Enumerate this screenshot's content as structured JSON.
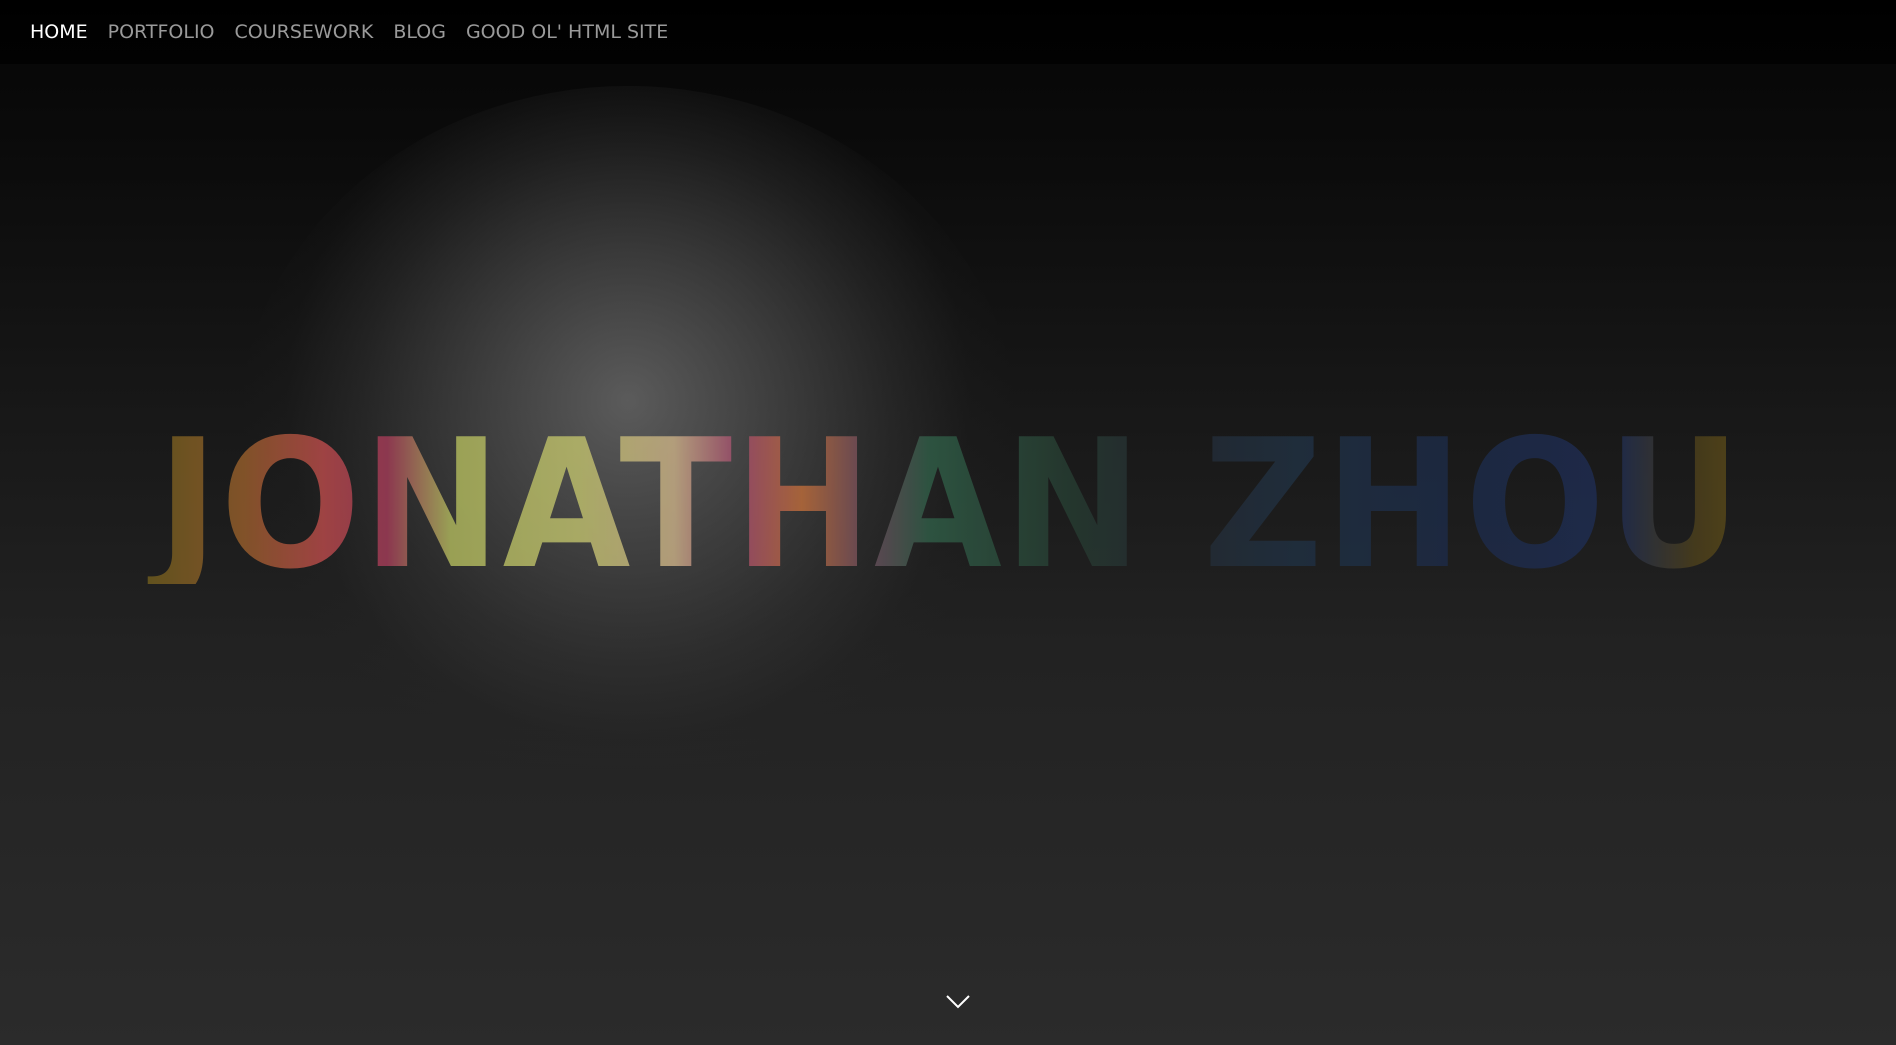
{
  "nav": {
    "items": [
      {
        "label": "HOME",
        "active": true
      },
      {
        "label": "PORTFOLIO",
        "active": false
      },
      {
        "label": "COURSEWORK",
        "active": false
      },
      {
        "label": "BLOG",
        "active": false
      },
      {
        "label": "GOOD OL' HTML SITE",
        "active": false
      }
    ]
  },
  "hero": {
    "title": "JONATHAN ZHOU"
  },
  "colors": {
    "background_top": "#050505",
    "background_bottom": "#2b2b2b",
    "nav_active": "#ffffff",
    "nav_inactive": "#9a9a9a",
    "title_palette": [
      "#c9a13a",
      "#d0483f",
      "#c2d050",
      "#d8c060",
      "#c48a8a",
      "#b0445a",
      "#2f6a4a",
      "#2e4a5a",
      "#2a3550",
      "#28406a",
      "#c99a2a"
    ]
  },
  "icons": {
    "scroll_down": "chevron-down-icon"
  }
}
